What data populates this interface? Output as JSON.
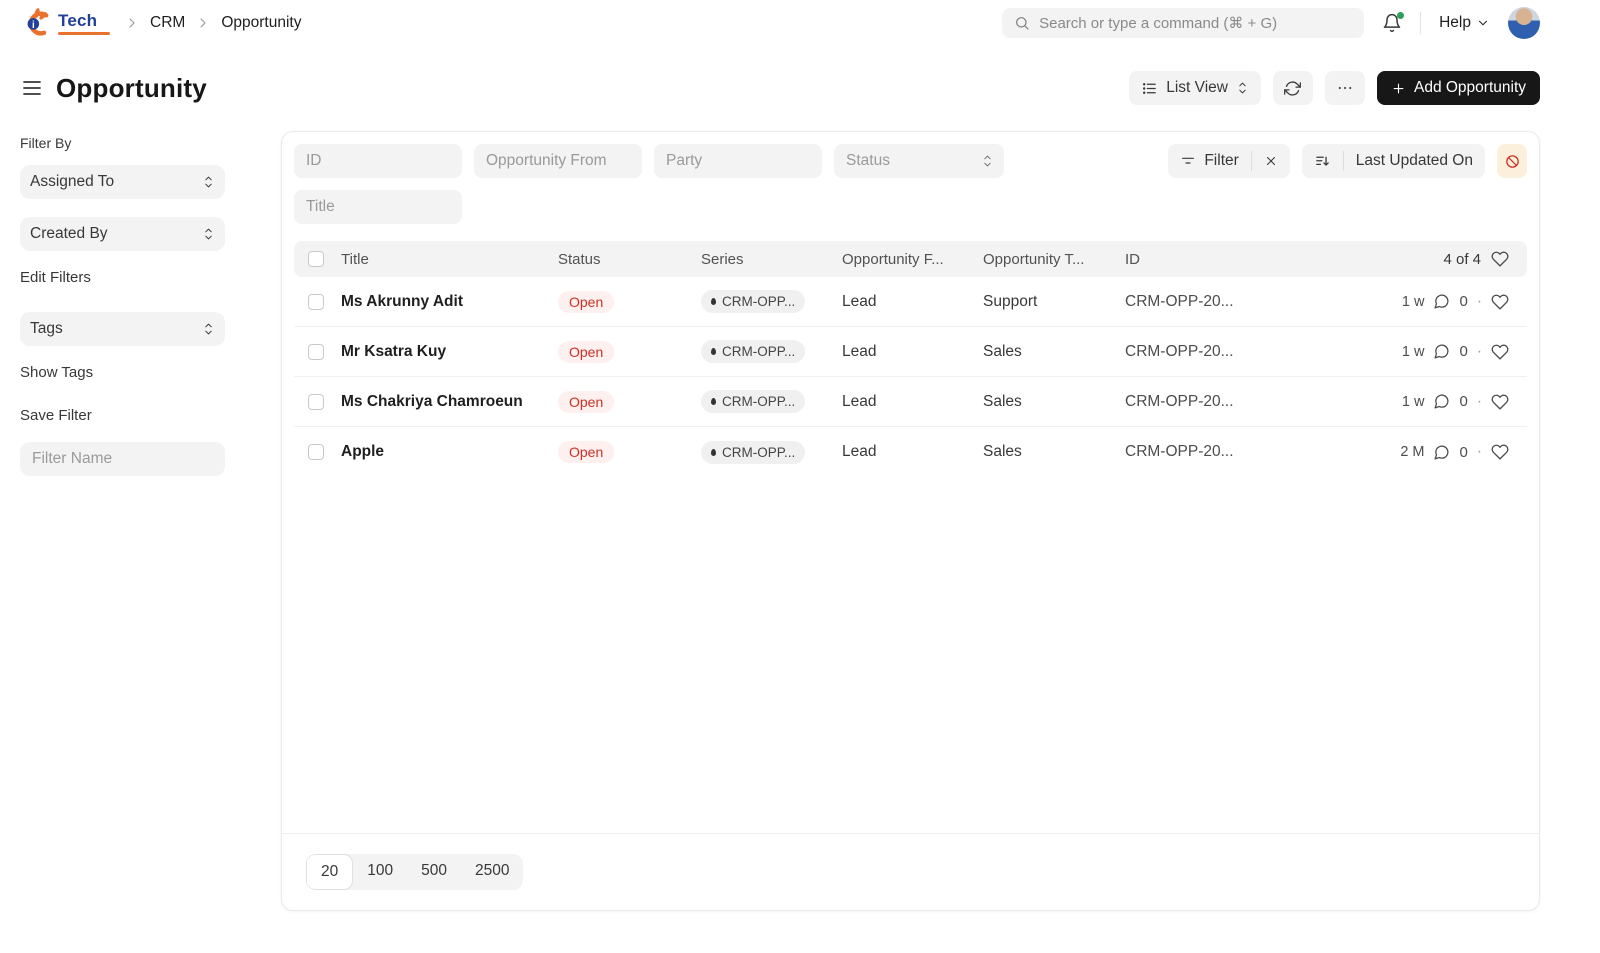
{
  "topbar": {
    "logo_text": "Tech",
    "breadcrumb": [
      "CRM",
      "Opportunity"
    ],
    "search_placeholder": "Search or type a command (⌘ + G)",
    "help_label": "Help"
  },
  "header": {
    "title": "Opportunity",
    "view_switcher_label": "List View",
    "add_button_label": "Add Opportunity"
  },
  "sidebar": {
    "filter_by_label": "Filter By",
    "assigned_to_label": "Assigned To",
    "created_by_label": "Created By",
    "edit_filters_label": "Edit Filters",
    "tags_label": "Tags",
    "show_tags_label": "Show Tags",
    "save_filter_label": "Save Filter",
    "filter_name_placeholder": "Filter Name"
  },
  "filters": {
    "id_placeholder": "ID",
    "opportunity_from_placeholder": "Opportunity From",
    "party_placeholder": "Party",
    "status_placeholder": "Status",
    "title_placeholder": "Title",
    "filter_button_label": "Filter",
    "sort_button_label": "Last Updated On"
  },
  "table": {
    "columns": {
      "title": "Title",
      "status": "Status",
      "series": "Series",
      "opportunity_from": "Opportunity F...",
      "opportunity_type": "Opportunity T...",
      "id": "ID"
    },
    "count_label": "4 of 4",
    "rows": [
      {
        "title": "Ms Akrunny Adit",
        "status": "Open",
        "series": "CRM-OPP...",
        "opportunity_from": "Lead",
        "opportunity_type": "Support",
        "id": "CRM-OPP-20...",
        "modified": "1 w",
        "comment_count": "0"
      },
      {
        "title": "Mr Ksatra Kuy",
        "status": "Open",
        "series": "CRM-OPP...",
        "opportunity_from": "Lead",
        "opportunity_type": "Sales",
        "id": "CRM-OPP-20...",
        "modified": "1 w",
        "comment_count": "0"
      },
      {
        "title": "Ms Chakriya Chamroeun",
        "status": "Open",
        "series": "CRM-OPP...",
        "opportunity_from": "Lead",
        "opportunity_type": "Sales",
        "id": "CRM-OPP-20...",
        "modified": "1 w",
        "comment_count": "0"
      },
      {
        "title": "Apple",
        "status": "Open",
        "series": "CRM-OPP...",
        "opportunity_from": "Lead",
        "opportunity_type": "Sales",
        "id": "CRM-OPP-20...",
        "modified": "2 M",
        "comment_count": "0"
      }
    ]
  },
  "pagination": {
    "options": [
      "20",
      "100",
      "500",
      "2500"
    ],
    "selected": "20"
  },
  "colors": {
    "accent_dark": "#171717",
    "control_bg": "#F3F3F3",
    "status_open_bg": "#FDF0EF",
    "status_open_text": "#CE3124",
    "warn_button_bg": "#FAF0DC",
    "warn_icon_color": "#CE3124",
    "notification_dot": "#2E9E5B",
    "logo_orange": "#E9722E",
    "logo_navy": "#21409A"
  }
}
